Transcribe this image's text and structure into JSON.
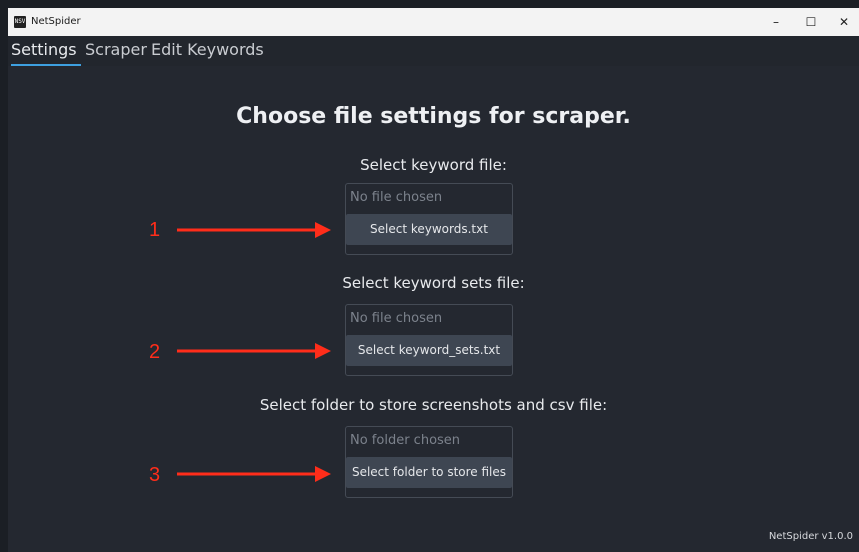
{
  "window": {
    "title": "NetSpider",
    "icon_text": "NSV",
    "controls": {
      "minimize": "–",
      "maximize": "☐",
      "close": "✕"
    }
  },
  "menu": {
    "tabs": [
      {
        "label": "Settings",
        "active": true
      },
      {
        "label": "Scraper",
        "active": false
      },
      {
        "label": "Edit Keywords",
        "active": false
      }
    ]
  },
  "main": {
    "heading": "Choose file settings for scraper.",
    "sections": [
      {
        "label": "Select keyword file:",
        "status": "No file chosen",
        "button": "Select keywords.txt",
        "marker": "1"
      },
      {
        "label": "Select keyword sets file:",
        "status": "No file chosen",
        "button": "Select keyword_sets.txt",
        "marker": "2"
      },
      {
        "label": "Select folder to store screenshots and csv file:",
        "status": "No folder chosen",
        "button": "Select folder to store files",
        "marker": "3"
      }
    ]
  },
  "footer": {
    "version": "NetSpider v1.0.0"
  },
  "colors": {
    "background": "#242830",
    "accent": "#3ea0e0",
    "button": "#3e4652",
    "annotation": "#ff2d1a"
  }
}
